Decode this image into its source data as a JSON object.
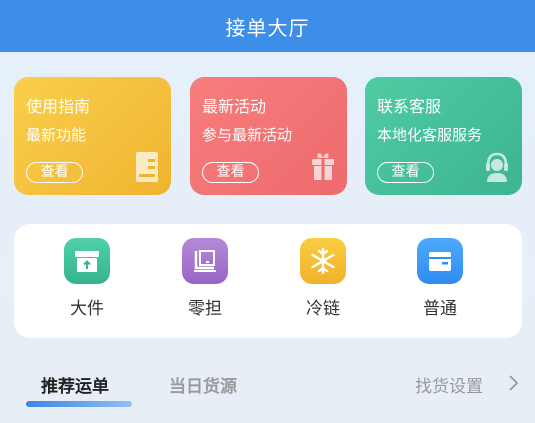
{
  "header": {
    "title": "接单大厅"
  },
  "cards": [
    {
      "title": "使用指南",
      "subtitle": "最新功能",
      "button": "查看",
      "icon": "document-icon"
    },
    {
      "title": "最新活动",
      "subtitle": "参与最新活动",
      "button": "查看",
      "icon": "gift-icon"
    },
    {
      "title": "联系客服",
      "subtitle": "本地化客服服务",
      "button": "查看",
      "icon": "headset-icon"
    }
  ],
  "categories": [
    {
      "label": "大件",
      "icon": "box-upload-icon",
      "color": "#3db492"
    },
    {
      "label": "零担",
      "icon": "pallet-icon",
      "color": "#9864c8"
    },
    {
      "label": "冷链",
      "icon": "snowflake-icon",
      "color": "#f1b12a"
    },
    {
      "label": "普通",
      "icon": "package-icon",
      "color": "#2f8cf0"
    }
  ],
  "tabs": {
    "active": "推荐运单",
    "inactive": "当日货源"
  },
  "settings_link": "找货设置",
  "colors": {
    "header": "#3d8ee8",
    "accent": "#3d83e6"
  }
}
